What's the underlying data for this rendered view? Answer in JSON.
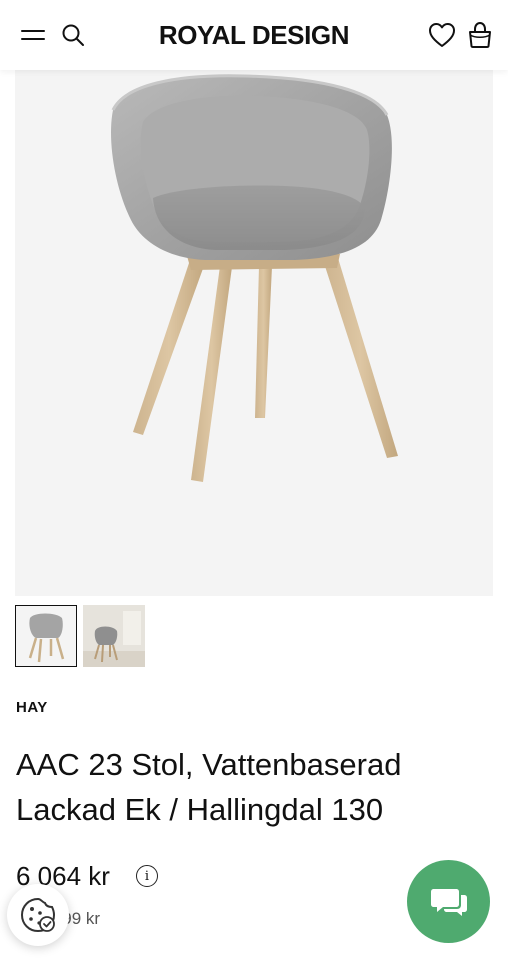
{
  "header": {
    "logo_text": "ROYAL DESIGN",
    "icons": [
      "menu-icon",
      "search-icon",
      "heart-icon",
      "shopping-bag-icon"
    ]
  },
  "gallery": {
    "main_image": "product-chair-image",
    "thumbnails": [
      "thumbnail-chair-front",
      "thumbnail-chair-room"
    ],
    "active_index": 0
  },
  "product": {
    "brand": "HAY",
    "title_line1": "AAC 23 Stol, Vattenbaserad",
    "title_line2": "Lackad Ek / Hallingdal 130",
    "price": "6 064 kr",
    "original_price_text": "ris 7 899 kr"
  },
  "floating": {
    "cookie_icon": "cookie-icon",
    "chat_icon": "chat-bubble-icon",
    "chat_color": "#4faa6f"
  }
}
